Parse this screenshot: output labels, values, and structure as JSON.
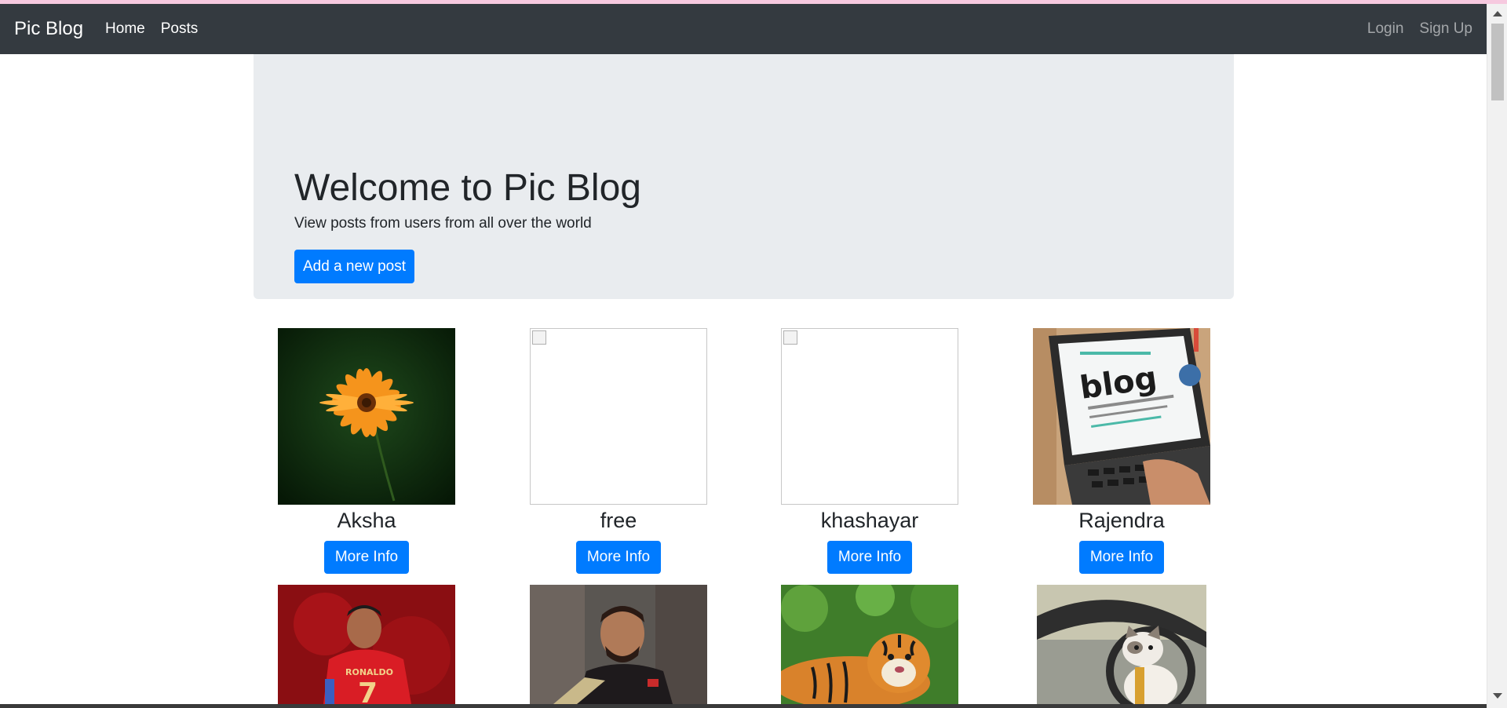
{
  "navbar": {
    "brand": "Pic Blog",
    "links": [
      {
        "label": "Home"
      },
      {
        "label": "Posts"
      }
    ],
    "auth": [
      {
        "label": "Login"
      },
      {
        "label": "Sign Up"
      }
    ]
  },
  "hero": {
    "title": "Welcome to Pic Blog",
    "subtitle": "View posts from users from all over the world",
    "add_button": "Add a new post"
  },
  "posts": [
    {
      "name": "Aksha",
      "button": "More Info",
      "image": "flower"
    },
    {
      "name": "free",
      "button": "More Info",
      "image": "broken"
    },
    {
      "name": "khashayar",
      "button": "More Info",
      "image": "broken"
    },
    {
      "name": "Rajendra",
      "button": "More Info",
      "image": "blog-laptop"
    },
    {
      "image": "ronaldo",
      "image_text": "RONALDO"
    },
    {
      "image": "cricketer"
    },
    {
      "image": "tiger"
    },
    {
      "image": "cat-in-car"
    }
  ],
  "colors": {
    "navbar": "#343a40",
    "primary": "#007bff",
    "jumbotron": "#e9ecef"
  }
}
